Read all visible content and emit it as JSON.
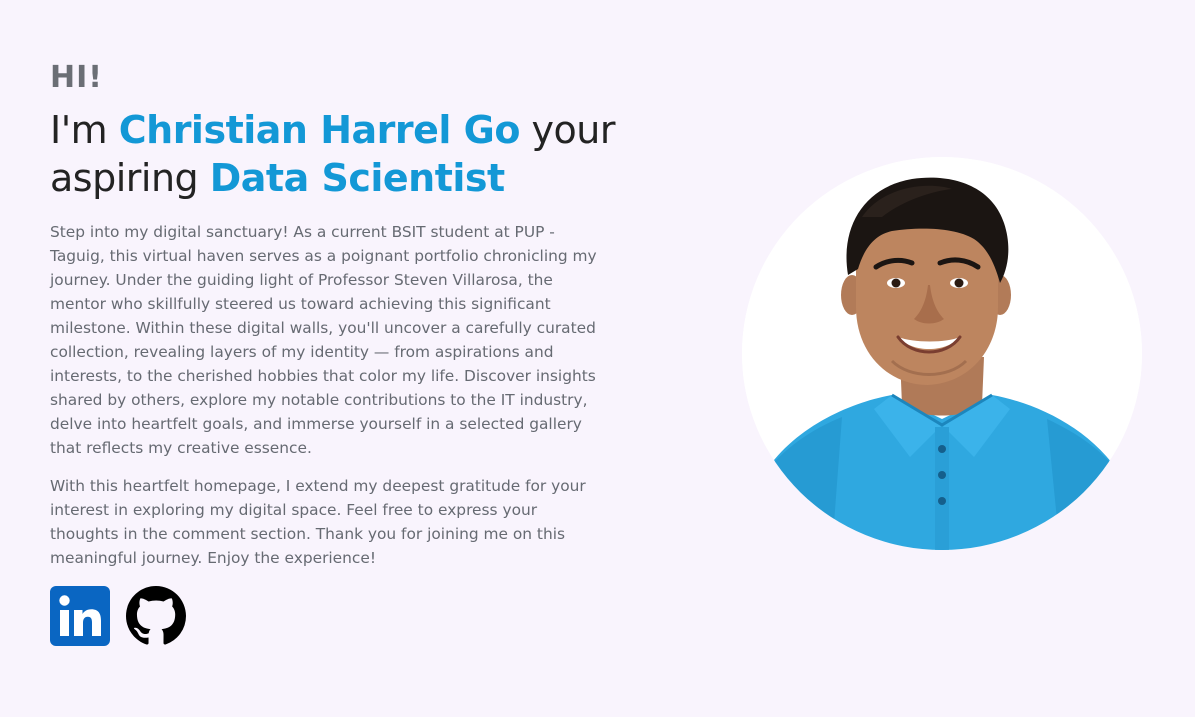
{
  "hero": {
    "greeting": "HI!",
    "headline_prefix": "I'm ",
    "name": "Christian Harrel Go",
    "headline_middle": " your aspiring ",
    "role": "Data Scientist",
    "bio_paragraph_1": "Step into my digital sanctuary! As a current BSIT student at PUP - Taguig, this virtual haven serves as a poignant portfolio chronicling my journey. Under the guiding light of Professor Steven Villarosa, the mentor who skillfully steered us toward achieving this significant milestone. Within these digital walls, you'll uncover a carefully curated collection, revealing layers of my identity — from aspirations and interests, to the cherished hobbies that color my life. Discover insights shared by others, explore my notable contributions to the IT industry, delve into heartfelt goals, and immerse yourself in a selected gallery that reflects my creative essence.",
    "bio_paragraph_2": "With this heartfelt homepage, I extend my deepest gratitude for your interest in exploring my digital space. Feel free to express your thoughts in the comment section. Thank you for joining me on this meaningful journey. Enjoy the experience!"
  },
  "socials": [
    {
      "name": "linkedin",
      "icon": "linkedin-icon",
      "color": "#0a66c2"
    },
    {
      "name": "github",
      "icon": "github-icon",
      "color": "#000000"
    }
  ],
  "profile_photo": {
    "subject": "smiling young man in a light blue polo shirt",
    "shirt_color": "#2fa8e0",
    "background_color": "#ffffff"
  },
  "colors": {
    "page_background": "#f9f4fd",
    "accent": "#1398d6",
    "heading": "#232323",
    "body_text": "#666a72"
  }
}
